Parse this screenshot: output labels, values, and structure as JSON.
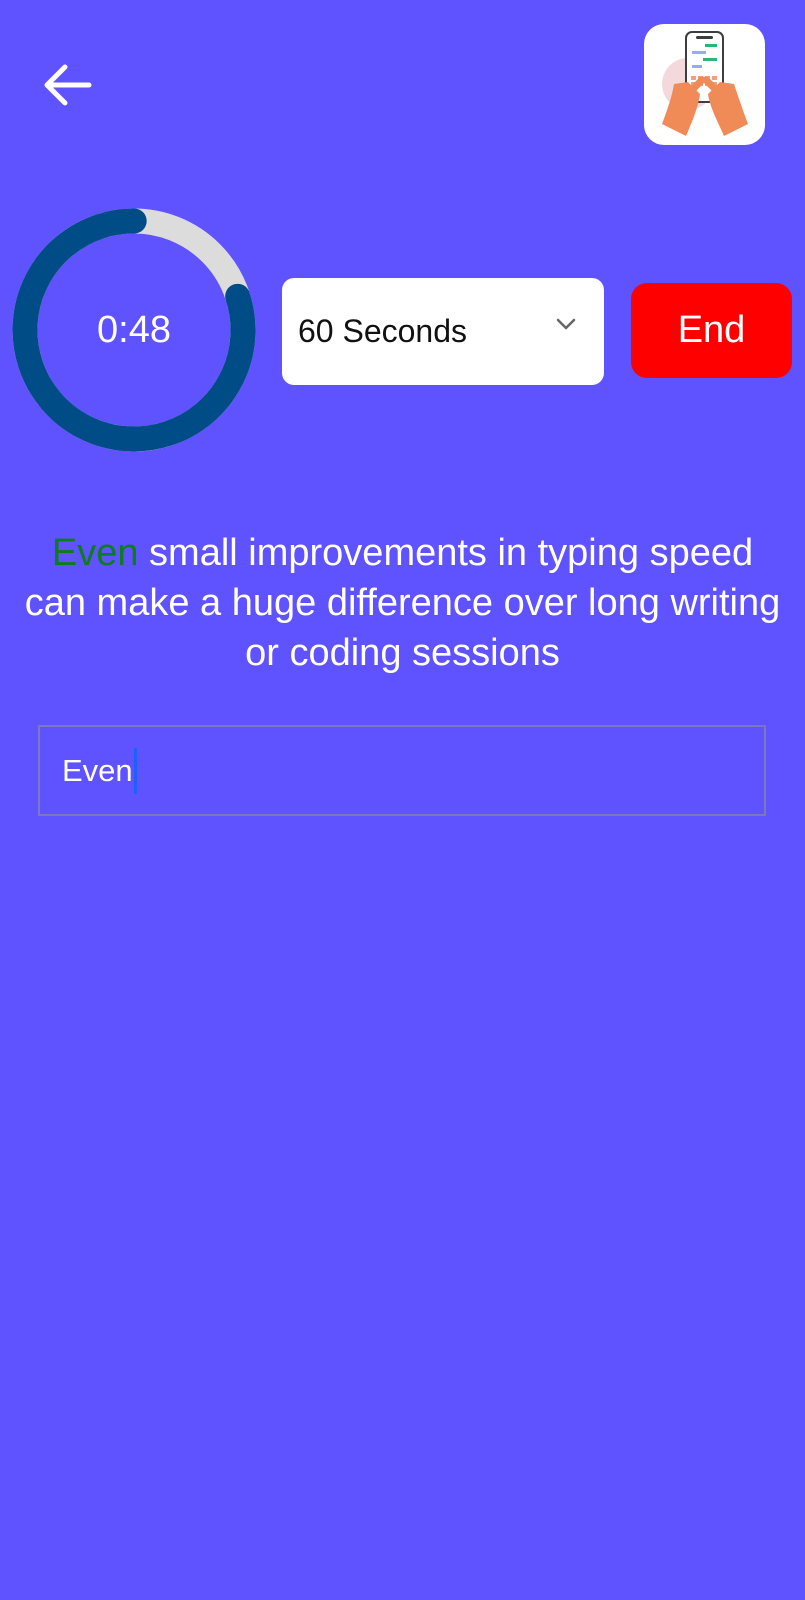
{
  "header": {
    "back_icon": "arrow-left-icon",
    "app_icon": "hands-typing-phone-icon"
  },
  "timer": {
    "time_text": "0:48",
    "remaining_fraction": 0.8,
    "track_color": "#dcdcdc",
    "progress_color": "#004c87"
  },
  "duration_select": {
    "selected_label": "60 Seconds",
    "icon": "chevron-down-icon"
  },
  "end_button": {
    "label": "End",
    "color": "#ff0000"
  },
  "passage": {
    "typed_portion": "Even",
    "remaining_portion": " small improvements in typing speed can make a huge difference over long writing or coding sessions",
    "typed_color": "#0f7b1f"
  },
  "typing_input": {
    "value": "Even"
  },
  "colors": {
    "background": "#5f52ff"
  }
}
